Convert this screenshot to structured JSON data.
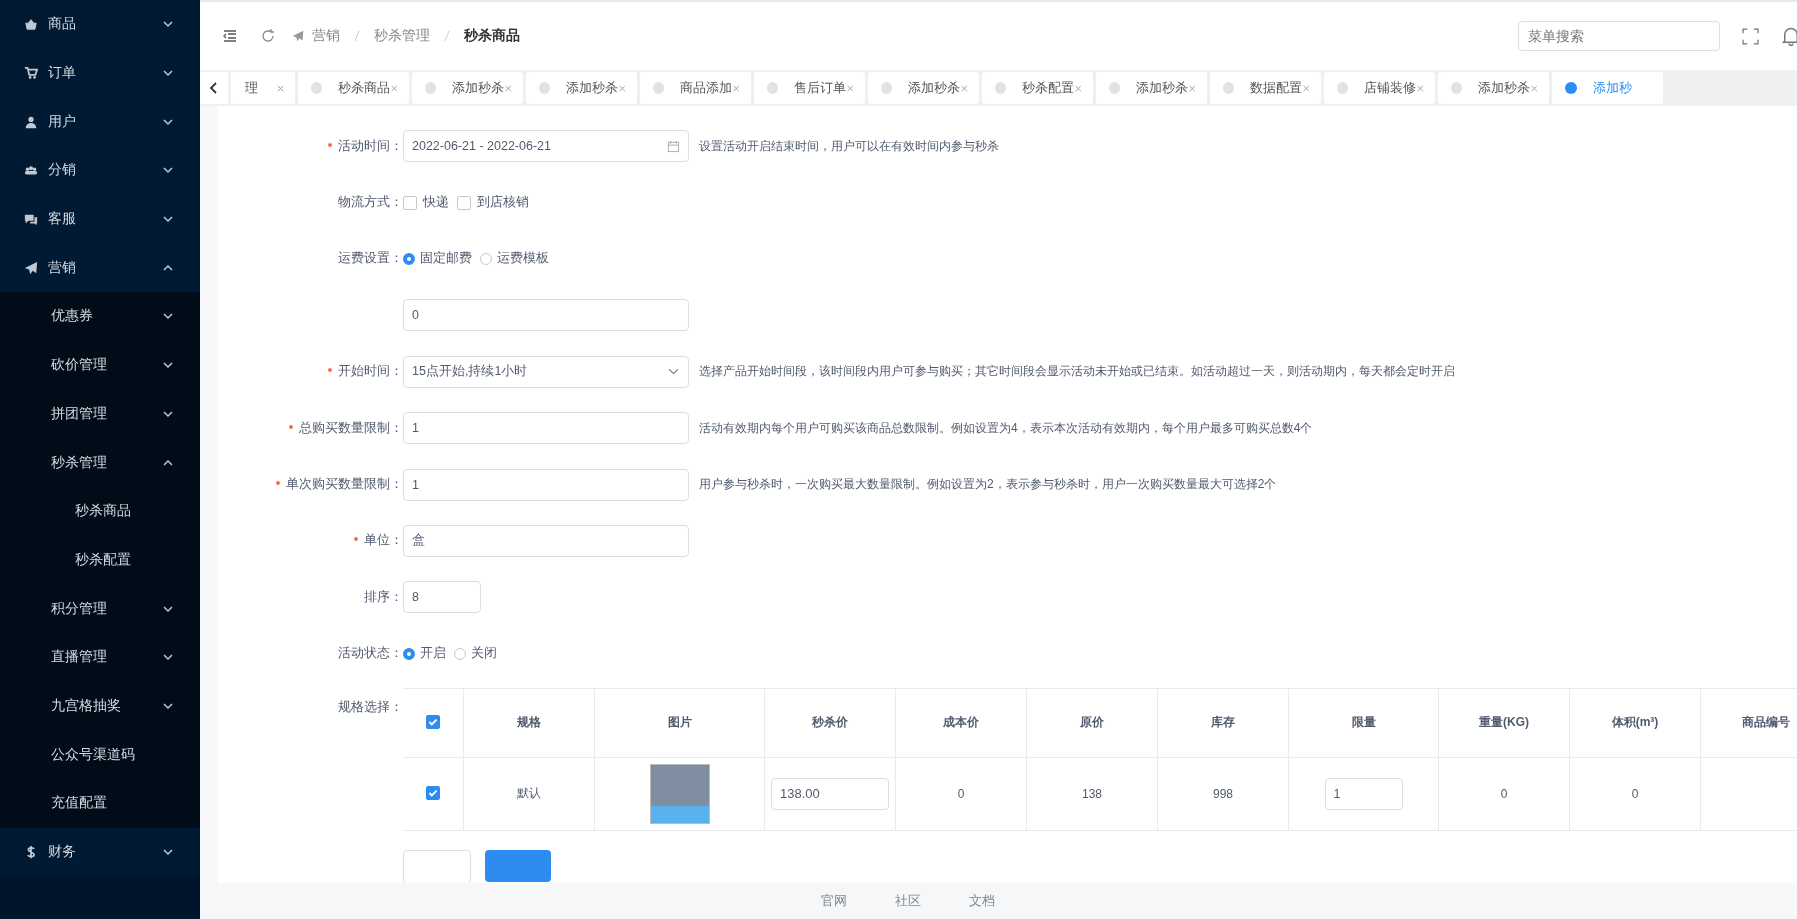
{
  "sidebar": {
    "items": [
      {
        "label": "商品",
        "expanded": false
      },
      {
        "label": "订单",
        "expanded": false
      },
      {
        "label": "用户",
        "expanded": false
      },
      {
        "label": "分销",
        "expanded": false
      },
      {
        "label": "客服",
        "expanded": false
      },
      {
        "label": "营销",
        "expanded": true,
        "children": [
          {
            "label": "优惠券",
            "expanded": false
          },
          {
            "label": "砍价管理",
            "expanded": false
          },
          {
            "label": "拼团管理",
            "expanded": false
          },
          {
            "label": "秒杀管理",
            "expanded": true,
            "children": [
              {
                "label": "秒杀商品"
              },
              {
                "label": "秒杀配置"
              }
            ]
          },
          {
            "label": "积分管理",
            "expanded": false
          },
          {
            "label": "直播管理",
            "expanded": false
          },
          {
            "label": "九宫格抽奖",
            "expanded": false
          },
          {
            "label": "公众号渠道码"
          },
          {
            "label": "充值配置"
          }
        ]
      },
      {
        "label": "财务",
        "expanded": false
      }
    ]
  },
  "header": {
    "breadcrumb": [
      "营销",
      "秒杀管理",
      "秒杀商品"
    ],
    "search": {
      "placeholder": "菜单搜索"
    }
  },
  "tabs": [
    {
      "label": "理",
      "selected": false
    },
    {
      "label": "秒杀商品",
      "selected": false
    },
    {
      "label": "添加秒杀",
      "selected": false
    },
    {
      "label": "添加秒杀",
      "selected": false
    },
    {
      "label": "商品添加",
      "selected": false
    },
    {
      "label": "售后订单",
      "selected": false
    },
    {
      "label": "添加秒杀",
      "selected": false
    },
    {
      "label": "秒杀配置",
      "selected": false
    },
    {
      "label": "添加秒杀",
      "selected": false
    },
    {
      "label": "数据配置",
      "selected": false
    },
    {
      "label": "店铺装修",
      "selected": false
    },
    {
      "label": "添加秒杀",
      "selected": false
    },
    {
      "label": "添加秒",
      "selected": true
    }
  ],
  "form": {
    "fields": [
      {
        "kind": "date",
        "label": "活动时间：",
        "required": true,
        "value": "2022-06-21 - 2022-06-21",
        "hint": "设置活动开启结束时间，用户可以在有效时间内参与秒杀"
      },
      {
        "kind": "checks",
        "label": "物流方式：",
        "required": false,
        "options": [
          {
            "label": "快递",
            "checked": false
          },
          {
            "label": "到店核销",
            "checked": false
          }
        ]
      },
      {
        "kind": "radios",
        "label": "运费设置：",
        "required": false,
        "options": [
          {
            "label": "固定邮费",
            "selected": true
          },
          {
            "label": "运费模板",
            "selected": false
          }
        ]
      },
      {
        "kind": "input",
        "value": "0"
      },
      {
        "kind": "select",
        "label": "开始时间：",
        "required": true,
        "value": "15点开始,持续1小时",
        "hint": "选择产品开始时间段，该时间段内用户可参与购买；其它时间段会显示活动未开始或已结束。如活动超过一天，则活动期内，每天都会定时开启"
      },
      {
        "kind": "input",
        "label": "总购买数量限制：",
        "required": true,
        "value": "1",
        "hint": "活动有效期内每个用户可购买该商品总数限制。例如设置为4，表示本次活动有效期内，每个用户最多可购买总数4个"
      },
      {
        "kind": "input",
        "label": "单次购买数量限制：",
        "required": true,
        "value": "1",
        "hint": "用户参与秒杀时，一次购买最大数量限制。例如设置为2，表示参与秒杀时，用户一次购买数量最大可选择2个"
      },
      {
        "kind": "input",
        "label": "单位：",
        "required": true,
        "value": "盒"
      },
      {
        "kind": "short_input",
        "label": "排序：",
        "required": false,
        "value": "8"
      },
      {
        "kind": "radios",
        "label": "活动状态：",
        "required": false,
        "options": [
          {
            "label": "开启",
            "selected": true
          },
          {
            "label": "关闭",
            "selected": false
          }
        ]
      },
      {
        "kind": "table",
        "label": "规格选择：",
        "required": false
      }
    ]
  },
  "spec_table": {
    "all_checked": true,
    "columns": [
      "规格",
      "图片",
      "秒杀价",
      "成本价",
      "原价",
      "库存",
      "限量",
      "重量(KG)",
      "体积(m³)",
      "商品编号"
    ],
    "rows": [
      {
        "checked": true,
        "spec": "默认",
        "price": "138.00",
        "cost": "0",
        "original": "138",
        "stock": "998",
        "limit": "1",
        "weight": "0",
        "volume": "0"
      }
    ]
  },
  "footer": {
    "links": [
      "官网",
      "社区",
      "文档"
    ]
  }
}
